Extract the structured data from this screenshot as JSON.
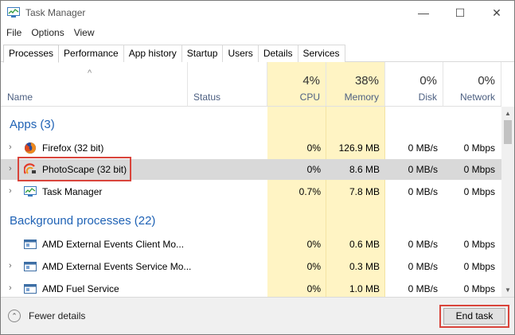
{
  "window": {
    "title": "Task Manager",
    "controls": {
      "minimize": "—",
      "maximize": "☐",
      "close": "✕"
    }
  },
  "menu": [
    "File",
    "Options",
    "View"
  ],
  "tabs": [
    {
      "label": "Processes",
      "active": true
    },
    {
      "label": "Performance"
    },
    {
      "label": "App history"
    },
    {
      "label": "Startup"
    },
    {
      "label": "Users"
    },
    {
      "label": "Details"
    },
    {
      "label": "Services"
    }
  ],
  "columns": {
    "name": "Name",
    "status": "Status",
    "cpu": {
      "label": "CPU",
      "percent": "4%"
    },
    "memory": {
      "label": "Memory",
      "percent": "38%"
    },
    "disk": {
      "label": "Disk",
      "percent": "0%"
    },
    "network": {
      "label": "Network",
      "percent": "0%"
    }
  },
  "sort_arrow": "^",
  "apps": {
    "header": "Apps (3)",
    "rows": [
      {
        "name": "Firefox (32 bit)",
        "icon": "firefox-icon",
        "cpu": "0%",
        "memory": "126.9 MB",
        "disk": "0 MB/s",
        "network": "0 Mbps"
      },
      {
        "name": "PhotoScape (32 bit)",
        "icon": "photoscape-icon",
        "cpu": "0%",
        "memory": "8.6 MB",
        "disk": "0 MB/s",
        "network": "0 Mbps",
        "selected": true
      },
      {
        "name": "Task Manager",
        "icon": "task-manager-icon",
        "cpu": "0.7%",
        "memory": "7.8 MB",
        "disk": "0 MB/s",
        "network": "0 Mbps"
      }
    ]
  },
  "background": {
    "header": "Background processes (22)",
    "rows": [
      {
        "name": "AMD External Events Client Mo...",
        "icon": "service-icon",
        "cpu": "0%",
        "memory": "0.6 MB",
        "disk": "0 MB/s",
        "network": "0 Mbps"
      },
      {
        "name": "AMD External Events Service Mo...",
        "icon": "service-icon",
        "cpu": "0%",
        "memory": "0.3 MB",
        "disk": "0 MB/s",
        "network": "0 Mbps"
      },
      {
        "name": "AMD Fuel Service",
        "icon": "service-icon",
        "cpu": "0%",
        "memory": "1.0 MB",
        "disk": "0 MB/s",
        "network": "0 Mbps"
      }
    ]
  },
  "footer": {
    "fewer_details": "Fewer details",
    "end_task": "End task"
  },
  "colors": {
    "group_header": "#1f62b5",
    "column_highlight": "#fff4c4",
    "selected_row": "#d9d9d9",
    "annotation": "#d9443b"
  }
}
